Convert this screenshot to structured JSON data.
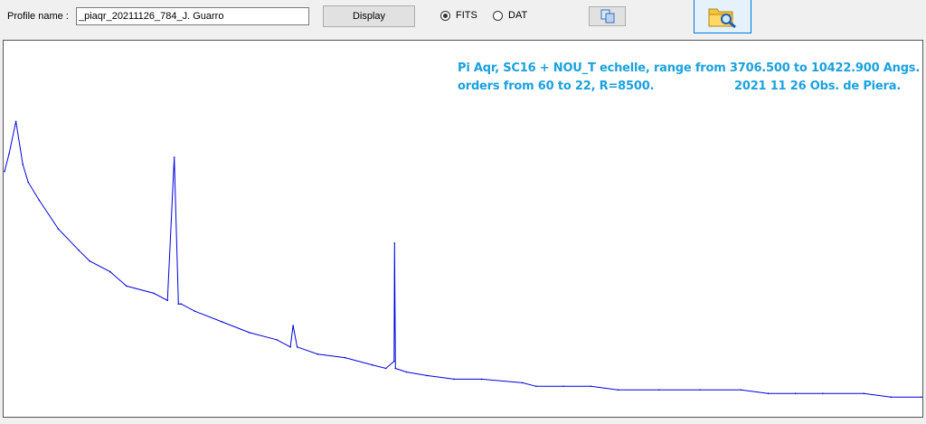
{
  "toolbar": {
    "profile_label": "Profile name :",
    "profile_value": "_piaqr_20211126_784_J. Guarro",
    "display_label": "Display",
    "radio_fits_label": "FITS",
    "radio_dat_label": "DAT",
    "selected_format": "FITS",
    "copy_icon": "copy-icon",
    "open_icon": "folder-search-icon"
  },
  "plot": {
    "caption_line1": "Pi Aqr, SC16 + NOU_T echelle, range from 3706.500 to 10422.900 Angs.",
    "caption_line2": "orders from 60 to 22, R=8500.",
    "caption_line3": "2021 11 26 Obs. de Piera.",
    "caption_color": "#1aa1e0",
    "trace_color": "#0000e0"
  },
  "chart_data": {
    "type": "line",
    "title": "Pi Aqr, SC16 + NOU_T echelle, range from 3706.500 to 10422.900 Angs.",
    "xlabel": "",
    "ylabel": "",
    "xlim": [
      3706.5,
      10422.9
    ],
    "ylim": [
      0,
      1
    ],
    "grid": false,
    "series": [
      {
        "x": [
          3706.5,
          3740,
          3790,
          3840,
          3880,
          3960,
          4100,
          4250,
          4330,
          4480,
          4600,
          4800,
          4900,
          4950,
          4980,
          5000,
          5100,
          5300,
          5500,
          5700,
          5800,
          5820,
          5850,
          6000,
          6200,
          6400,
          6500,
          6560,
          6563,
          6570,
          6650,
          6800,
          7000,
          7200,
          7500,
          7600,
          7800,
          8000,
          8200,
          8500,
          8800,
          9100,
          9300,
          9500,
          9700,
          10000,
          10200,
          10422.9
        ],
        "y": [
          0.68,
          0.73,
          0.82,
          0.7,
          0.65,
          0.6,
          0.52,
          0.46,
          0.43,
          0.4,
          0.36,
          0.34,
          0.32,
          0.72,
          0.31,
          0.31,
          0.29,
          0.26,
          0.23,
          0.21,
          0.19,
          0.25,
          0.19,
          0.17,
          0.16,
          0.14,
          0.13,
          0.15,
          0.48,
          0.13,
          0.12,
          0.11,
          0.1,
          0.1,
          0.09,
          0.08,
          0.08,
          0.08,
          0.07,
          0.07,
          0.07,
          0.07,
          0.06,
          0.06,
          0.06,
          0.06,
          0.05,
          0.05
        ]
      }
    ]
  }
}
